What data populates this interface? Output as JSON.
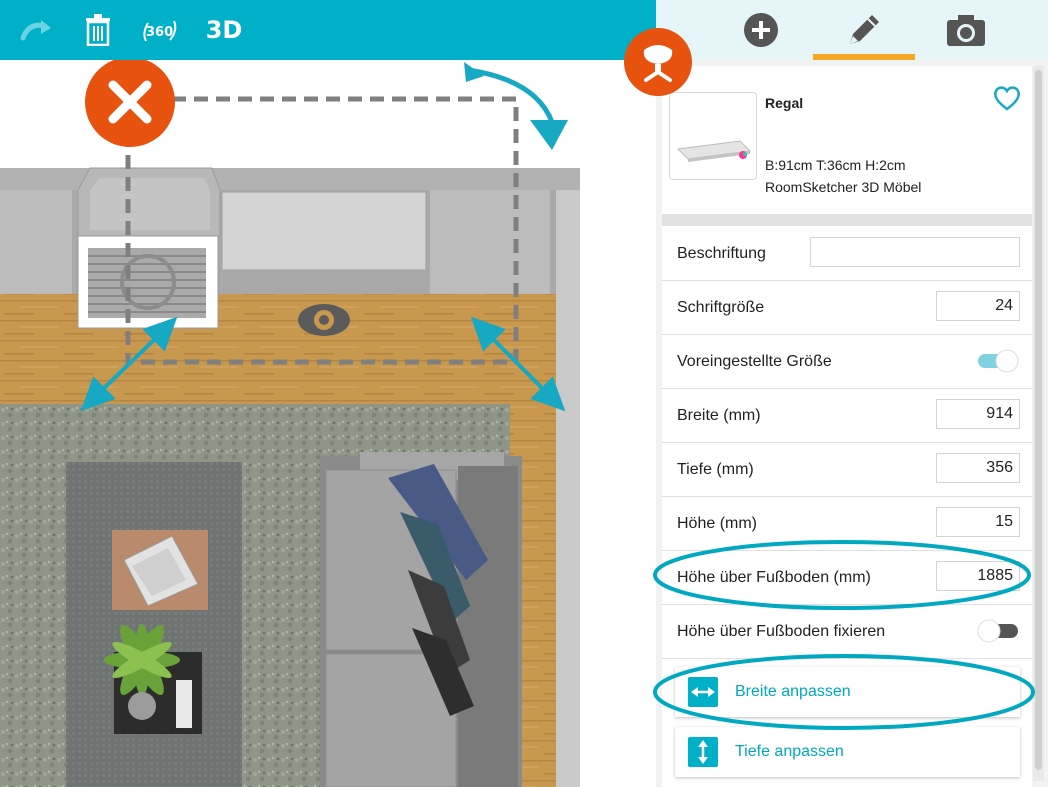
{
  "toolbar": {
    "three_d_label": "3D",
    "icons": [
      "redo-icon",
      "trash-icon",
      "360-view-icon"
    ],
    "view_360_label": "360"
  },
  "panel_tabs": [
    "add-icon",
    "pencil-icon",
    "camera-icon"
  ],
  "item": {
    "name": "Regal",
    "dimensions": "B:91cm T:36cm H:2cm",
    "source": "RoomSketcher 3D Möbel"
  },
  "properties": {
    "caption_label": "Beschriftung",
    "caption_value": "",
    "font_size_label": "Schriftgröße",
    "font_size_value": "24",
    "default_size_label": "Voreingestellte Größe",
    "default_size_on": true,
    "width_label": "Breite (mm)",
    "width_value": "914",
    "depth_label": "Tiefe (mm)",
    "depth_value": "356",
    "height_label": "Höhe (mm)",
    "height_value": "15",
    "elevation_label": "Höhe über Fußboden (mm)",
    "elevation_value": "1885",
    "elevation_lock_label": "Höhe über Fußboden fixieren",
    "elevation_lock_on": false
  },
  "actions": {
    "fit_width_label": "Breite anpassen",
    "fit_depth_label": "Tiefe anpassen"
  },
  "colors": {
    "accent": "#00b0c8",
    "delete": "#e8520f",
    "tab_underline": "#f5a623",
    "annotation": "#00a8c0"
  }
}
